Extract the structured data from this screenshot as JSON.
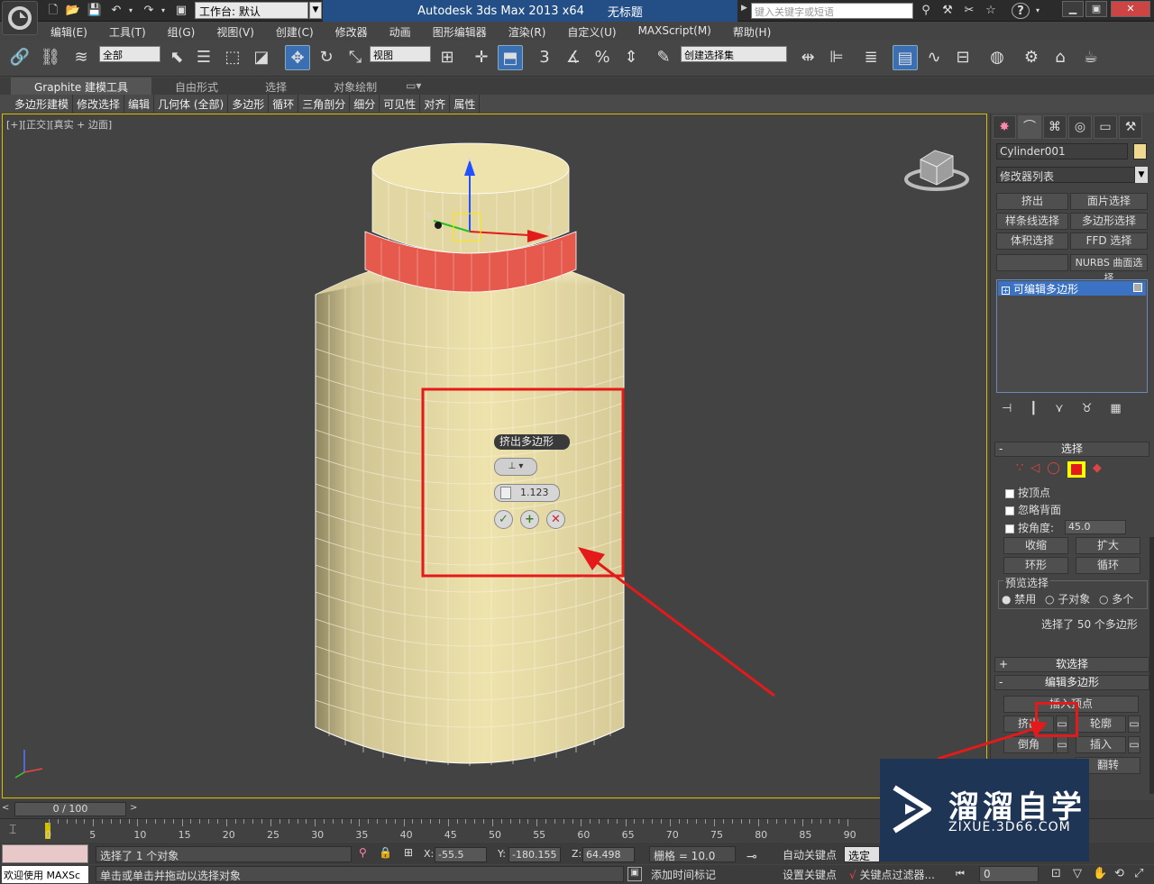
{
  "titlebar": {
    "workspace": "工作台: 默认",
    "app_title": "Autodesk 3ds Max  2013 x64",
    "file_title": "无标题",
    "search_placeholder": "键入关键字或短语",
    "help": "?"
  },
  "menu": [
    "编辑(E)",
    "工具(T)",
    "组(G)",
    "视图(V)",
    "创建(C)",
    "修改器",
    "动画",
    "图形编辑器",
    "渲染(R)",
    "自定义(U)",
    "MAXScript(M)",
    "帮助(H)"
  ],
  "toolbar": {
    "filter": "全部",
    "ref_coord": "视图",
    "snap_label": "3",
    "angle_label": "%",
    "selection_set": "创建选择集"
  },
  "ribbon": {
    "tabs": [
      "Graphite 建模工具",
      "自由形式",
      "选择",
      "对象绘制"
    ],
    "items": [
      "多边形建模",
      "修改选择",
      "编辑",
      "几何体 (全部)",
      "多边形",
      "循环",
      "三角剖分",
      "细分",
      "可见性",
      "对齐",
      "属性"
    ]
  },
  "viewport": {
    "label": "[+][正交][真实 + 边面]",
    "axis_z": "z",
    "axis_x": "x",
    "axis_y": "y"
  },
  "caddy": {
    "title": "挤出多边形",
    "height_value": "1.123",
    "ok": "✓",
    "apply": "+",
    "cancel": "✕"
  },
  "command_panel": {
    "object_name": "Cylinder001",
    "object_color": "#f0d890",
    "modifier_list": "修改器列表",
    "modifier_buttons": [
      "挤出",
      "面片选择",
      "样条线选择",
      "多边形选择",
      "体积选择",
      "FFD 选择",
      "",
      "NURBS 曲面选择"
    ],
    "stack_item": "可编辑多边形",
    "selection_rollout": "选择",
    "by_vertex": "按顶点",
    "ignore_backface": "忽略背面",
    "by_angle": "按角度:",
    "angle_value": "45.0",
    "shrink": "收缩",
    "grow": "扩大",
    "ring": "环形",
    "loop": "循环",
    "preview_selection": "预览选择",
    "preview_off": "禁用",
    "preview_subobj": "子对象",
    "preview_multi": "多个",
    "selected_info": "选择了 50 个多边形",
    "soft_selection": "软选择",
    "edit_polygons": "编辑多边形",
    "insert_vertex": "插入顶点",
    "extrude": "挤出",
    "outline": "轮廓",
    "bevel": "倒角",
    "inset": "插入",
    "flip": "翻转"
  },
  "timeline": {
    "slider": "0 / 100",
    "ticks": [
      "0",
      "5",
      "10",
      "15",
      "20",
      "25",
      "30",
      "35",
      "40",
      "45",
      "50",
      "55",
      "60",
      "65",
      "70",
      "75",
      "80",
      "85",
      "90"
    ]
  },
  "status": {
    "selection": "选择了 1 个对象",
    "prompt": "单击或单击并拖动以选择对象",
    "welcome": "欢迎使用 MAXSc",
    "x_label": "X:",
    "x": "-55.5",
    "y_label": "Y:",
    "y": "-180.155",
    "z_label": "Z:",
    "z": "64.498",
    "grid": "栅格 = 10.0",
    "auto_key": "自动关键点",
    "set_key": "设置关键点",
    "selected_dropdown": "选定对",
    "key_filters": "关键点过滤器...",
    "add_time_tag": "添加时间标记",
    "frame": "0"
  },
  "watermark": {
    "name": "溜溜自学",
    "url": "ZIXUE.3D66.COM"
  },
  "colors": {
    "accent_red": "#e41a1a",
    "selection_blue": "#3a6fb3",
    "viewport_border": "#d8c000"
  }
}
